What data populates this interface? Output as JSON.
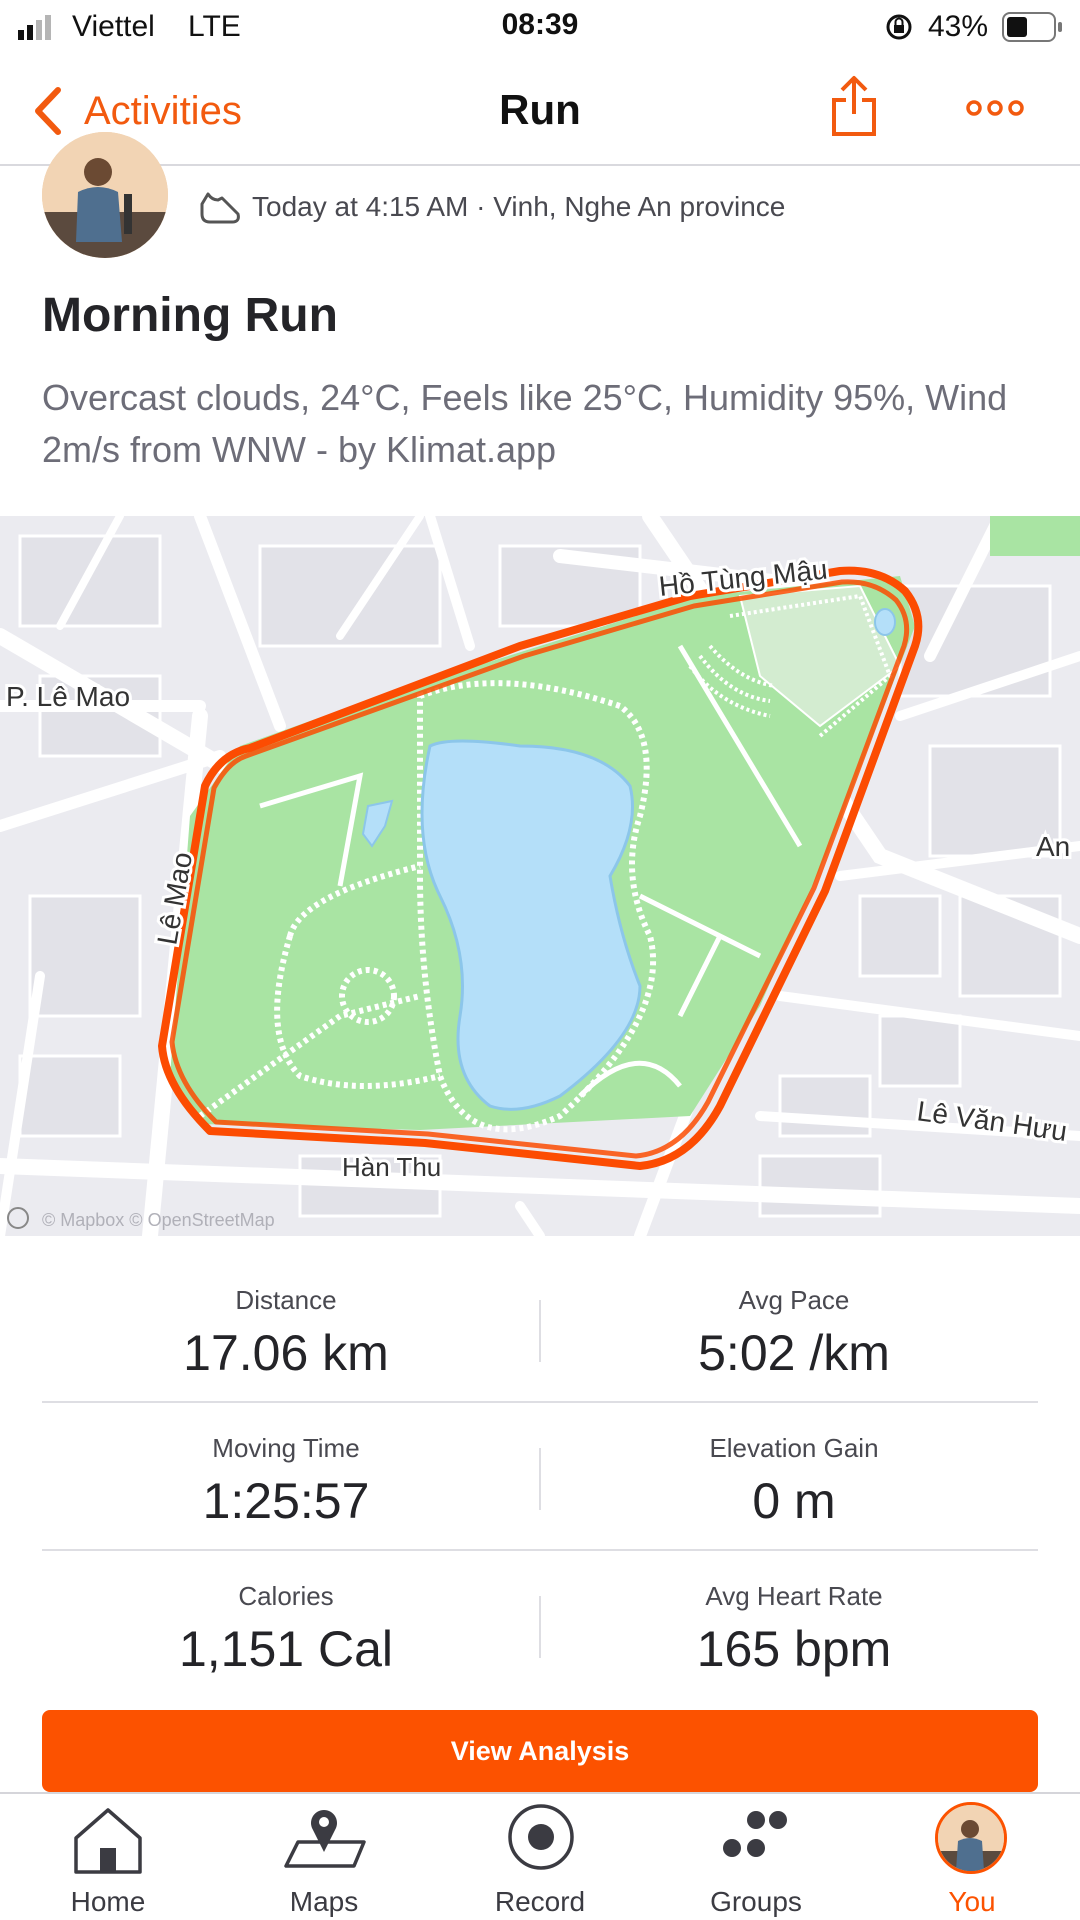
{
  "status_bar": {
    "carrier": "Viettel",
    "network": "LTE",
    "time": "08:39",
    "battery": "43%"
  },
  "nav": {
    "back_label": "Activities",
    "title": "Run",
    "share_icon": "share-icon",
    "more_icon": "more-icon"
  },
  "activity": {
    "meta": "Today at 4:15 AM · Vinh, Nghe An province",
    "shoe_icon": "shoe-icon",
    "title": "Morning Run",
    "description": "Overcast clouds, 24°C, Feels like 25°C, Humidity 95%, Wind 2m/s from WNW - by Klimat.app"
  },
  "map": {
    "labels": {
      "ho_tung_mau": "Hồ Tùng Mậu",
      "p_le_mao": "P. Lê Mao",
      "le_mao": "Lê Mao",
      "an": "An",
      "le_van_huu": "Lê Văn Hưu",
      "han_thu": "Hàn Thu"
    },
    "attribution": "© Mapbox © OpenStreetMap",
    "route_color": "#fc4c02",
    "park_color": "#a9e4a3",
    "water_color": "#b4dff9"
  },
  "stats": [
    {
      "label": "Distance",
      "value": "17.06 km"
    },
    {
      "label": "Avg Pace",
      "value": "5:02 /km"
    },
    {
      "label": "Moving Time",
      "value": "1:25:57"
    },
    {
      "label": "Elevation Gain",
      "value": "0 m"
    },
    {
      "label": "Calories",
      "value": "1,151 Cal"
    },
    {
      "label": "Avg Heart Rate",
      "value": "165 bpm"
    }
  ],
  "cta": {
    "label": "View Analysis"
  },
  "tabs": [
    {
      "label": "Home",
      "icon": "home-icon"
    },
    {
      "label": "Maps",
      "icon": "maps-icon"
    },
    {
      "label": "Record",
      "icon": "record-icon"
    },
    {
      "label": "Groups",
      "icon": "groups-icon"
    },
    {
      "label": "You",
      "icon": "avatar",
      "active": true
    }
  ],
  "colors": {
    "accent": "#fc5200",
    "text": "#242428",
    "muted": "#6d6d78"
  }
}
